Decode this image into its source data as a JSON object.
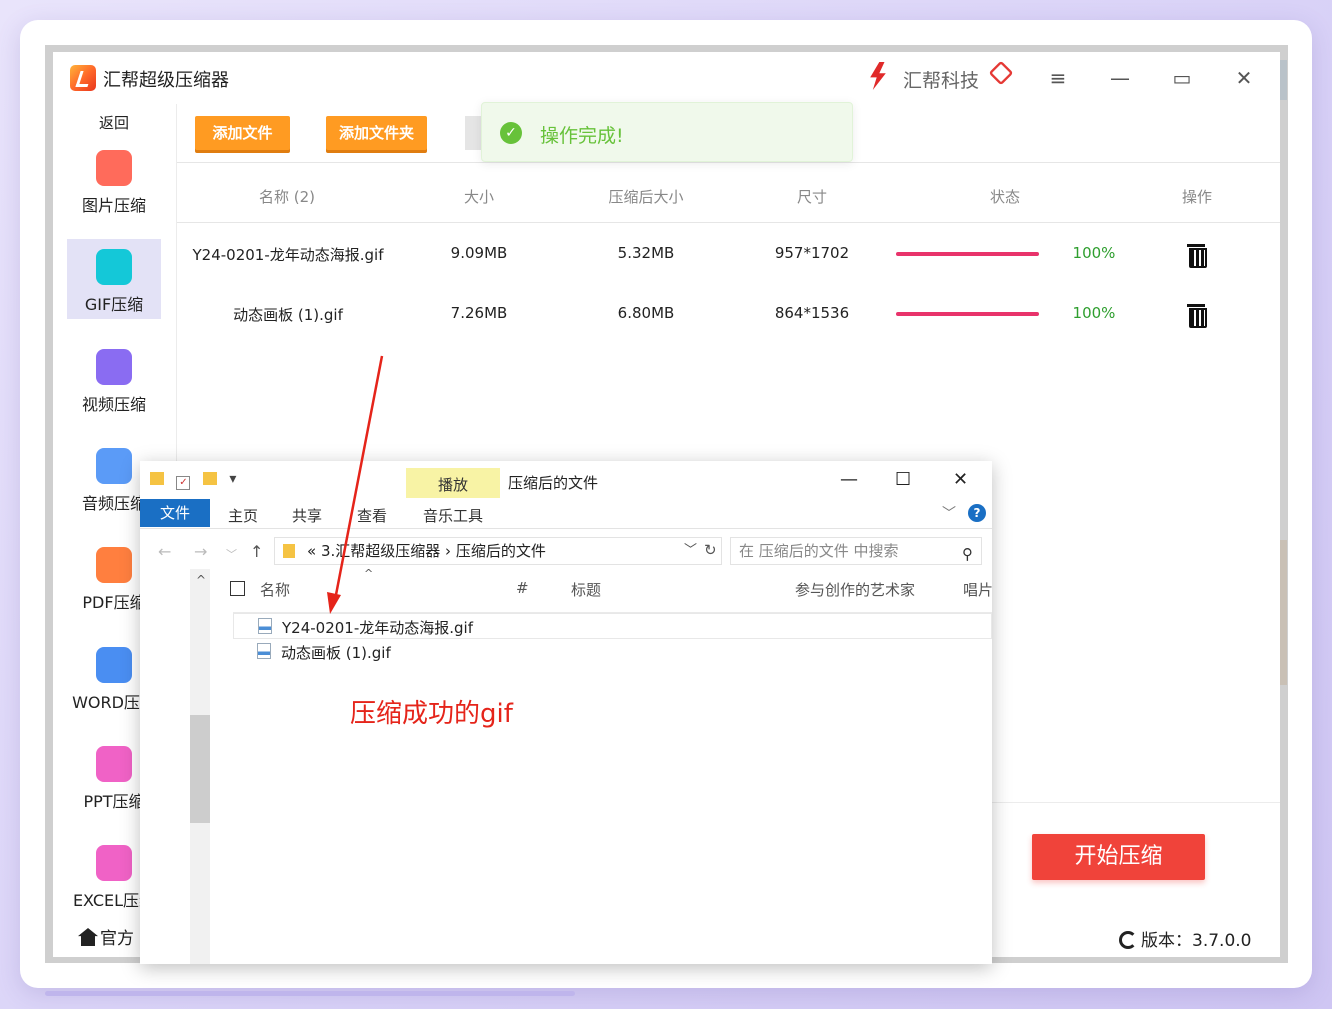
{
  "app": {
    "title": "汇帮超级压缩器",
    "brand": "汇帮科技",
    "back": "返回",
    "home": "官方",
    "version_label": "版本：3.7.0.0"
  },
  "sidebar": {
    "items": [
      {
        "label": "图片压缩",
        "icon": "image-icon",
        "color": "#ff6b5b"
      },
      {
        "label": "GIF压缩",
        "icon": "gif-icon",
        "color": "#14c8d8"
      },
      {
        "label": "视频压缩",
        "icon": "video-icon",
        "color": "#8a6cf2"
      },
      {
        "label": "音频压缩",
        "icon": "audio-icon",
        "color": "#5b9bf7"
      },
      {
        "label": "PDF压缩",
        "icon": "pdf-icon",
        "color": "#ff7f3f"
      },
      {
        "label": "WORD压缩",
        "icon": "word-icon",
        "color": "#4a8ef2"
      },
      {
        "label": "PPT压缩",
        "icon": "ppt-icon",
        "color": "#f062c6"
      },
      {
        "label": "EXCEL压缩",
        "icon": "excel-icon",
        "color": "#f062c6"
      }
    ]
  },
  "toolbar": {
    "add_file": "添加文件",
    "add_folder": "添加文件夹"
  },
  "toast": {
    "message": "操作完成!"
  },
  "table": {
    "headers": [
      "名称 (2)",
      "大小",
      "压缩后大小",
      "尺寸",
      "状态",
      "操作"
    ],
    "rows": [
      {
        "name": "Y24-0201-龙年动态海报.gif",
        "size": "9.09MB",
        "compressed": "5.32MB",
        "dims": "957*1702",
        "progress": 1.0,
        "pct": "100%"
      },
      {
        "name": "动态画板 (1).gif",
        "size": "7.26MB",
        "compressed": "6.80MB",
        "dims": "864*1536",
        "progress": 1.0,
        "pct": "100%"
      }
    ]
  },
  "actions": {
    "start": "开始压缩"
  },
  "explorer": {
    "title": "压缩后的文件",
    "play_tab": "播放",
    "music_tools": "音乐工具",
    "ribbon": [
      "文件",
      "主页",
      "共享",
      "查看"
    ],
    "address": {
      "prefix": "«",
      "parent": "3.汇帮超级压缩器",
      "current": "压缩后的文件"
    },
    "search_placeholder": "在 压缩后的文件 中搜索",
    "columns": [
      "名称",
      "#",
      "标题",
      "参与创作的艺术家",
      "唱片"
    ],
    "files": [
      "Y24-0201-龙年动态海报.gif",
      "动态画板 (1).gif"
    ]
  },
  "annotation": {
    "text": "压缩成功的gif",
    "color": "#e5241a"
  }
}
